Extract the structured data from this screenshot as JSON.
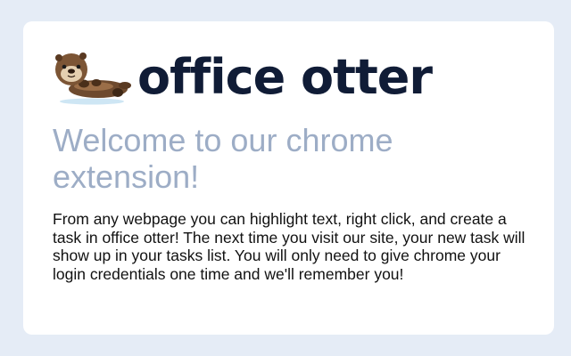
{
  "brand": {
    "name": "office otter",
    "logo_icon": "otter-icon"
  },
  "welcome": {
    "heading": "Welcome to our chrome extension!"
  },
  "description": {
    "text": "From any webpage you can highlight text, right click, and create a task in office otter! The next time you visit our site, your new task will show up in your tasks list. You will only need to give chrome your login credentials one time and we'll remember you!"
  },
  "colors": {
    "background": "#e5ecf6",
    "card": "#ffffff",
    "brand_text": "#101c36",
    "heading_text": "#9dadc6",
    "body_text": "#111111"
  }
}
